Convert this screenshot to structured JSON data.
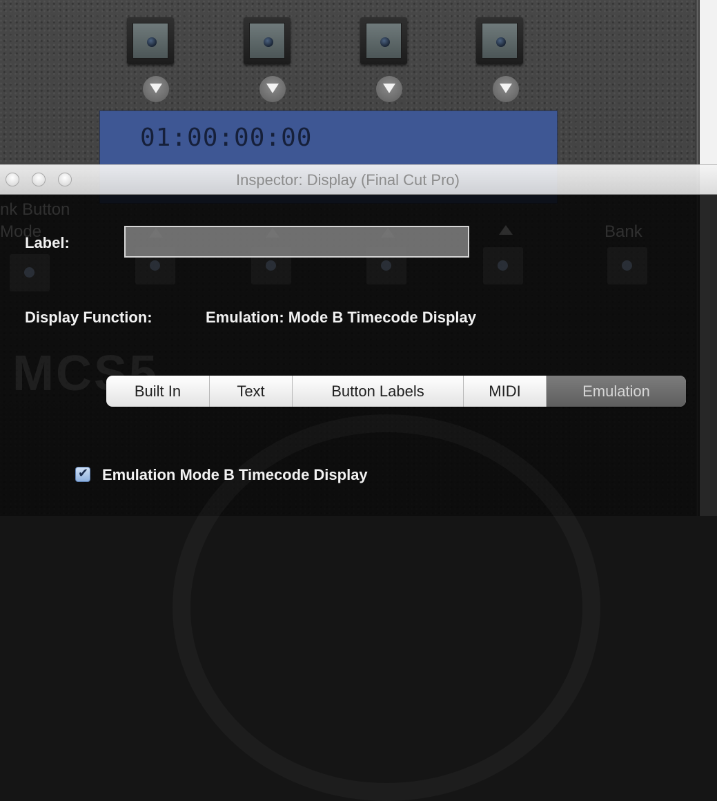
{
  "device": {
    "timecode": "01:00:00:00",
    "ghost_labels": {
      "bank_button_mode_line1": "nk Button",
      "bank_button_mode_line2": "Mode",
      "bank": "Bank",
      "logo": "MCS5"
    }
  },
  "window": {
    "title": "Inspector: Display (Final Cut Pro)"
  },
  "inspector": {
    "label_title": "Label:",
    "label_value": "",
    "display_function_title": "Display Function:",
    "display_function_value": "Emulation: Mode B Timecode Display",
    "tabs": [
      {
        "label": "Built In",
        "selected": false
      },
      {
        "label": "Text",
        "selected": false
      },
      {
        "label": "Button Labels",
        "selected": false
      },
      {
        "label": "MIDI",
        "selected": false
      },
      {
        "label": "Emulation",
        "selected": true
      }
    ],
    "checkbox_label": "Emulation Mode B Timecode Display",
    "checkbox_checked": true
  },
  "colors": {
    "lcd": "#3e5794",
    "selected_tab": "#6a6a6a",
    "checkbox": "#8fb1de"
  }
}
